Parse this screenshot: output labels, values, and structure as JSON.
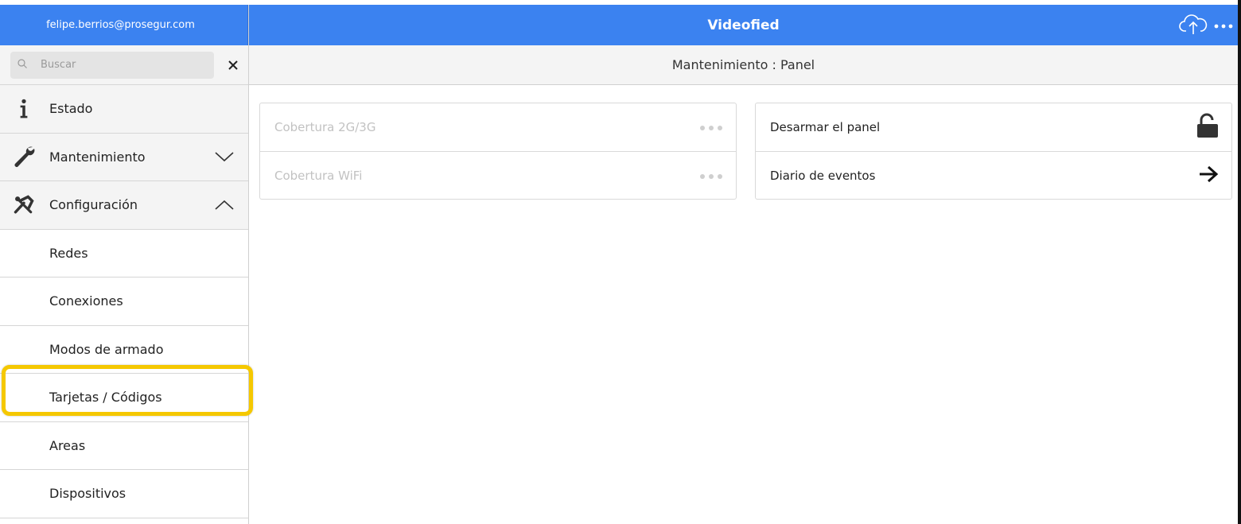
{
  "sidebar": {
    "user_email": "felipe.berrios@prosegur.com",
    "search": {
      "placeholder": "Buscar",
      "value": ""
    },
    "items": [
      {
        "label": "Estado",
        "icon": "info-icon"
      },
      {
        "label": "Mantenimiento",
        "icon": "wrench-icon",
        "expanded": false
      },
      {
        "label": "Configuración",
        "icon": "tools-icon",
        "expanded": true
      }
    ],
    "config_children": [
      "Redes",
      "Conexiones",
      "Modos de armado",
      "Tarjetas / Códigos",
      "Areas",
      "Dispositivos"
    ],
    "highlighted_item": "Tarjetas / Códigos"
  },
  "header": {
    "title": "Videofied"
  },
  "subheader": {
    "title": "Mantenimiento : Panel"
  },
  "left_card": {
    "rows": [
      {
        "label": "Cobertura 2G/3G",
        "action": "•••",
        "enabled": false
      },
      {
        "label": "Cobertura WiFi",
        "action": "•••",
        "enabled": false
      }
    ]
  },
  "right_card": {
    "rows": [
      {
        "label": "Desarmar el panel",
        "icon": "unlock-icon"
      },
      {
        "label": "Diario de eventos",
        "icon": "arrow-right-icon"
      }
    ]
  },
  "colors": {
    "header_blue": "#3b82f0",
    "highlight_yellow": "#f5c800",
    "sidebar_bg": "#f4f4f4"
  }
}
